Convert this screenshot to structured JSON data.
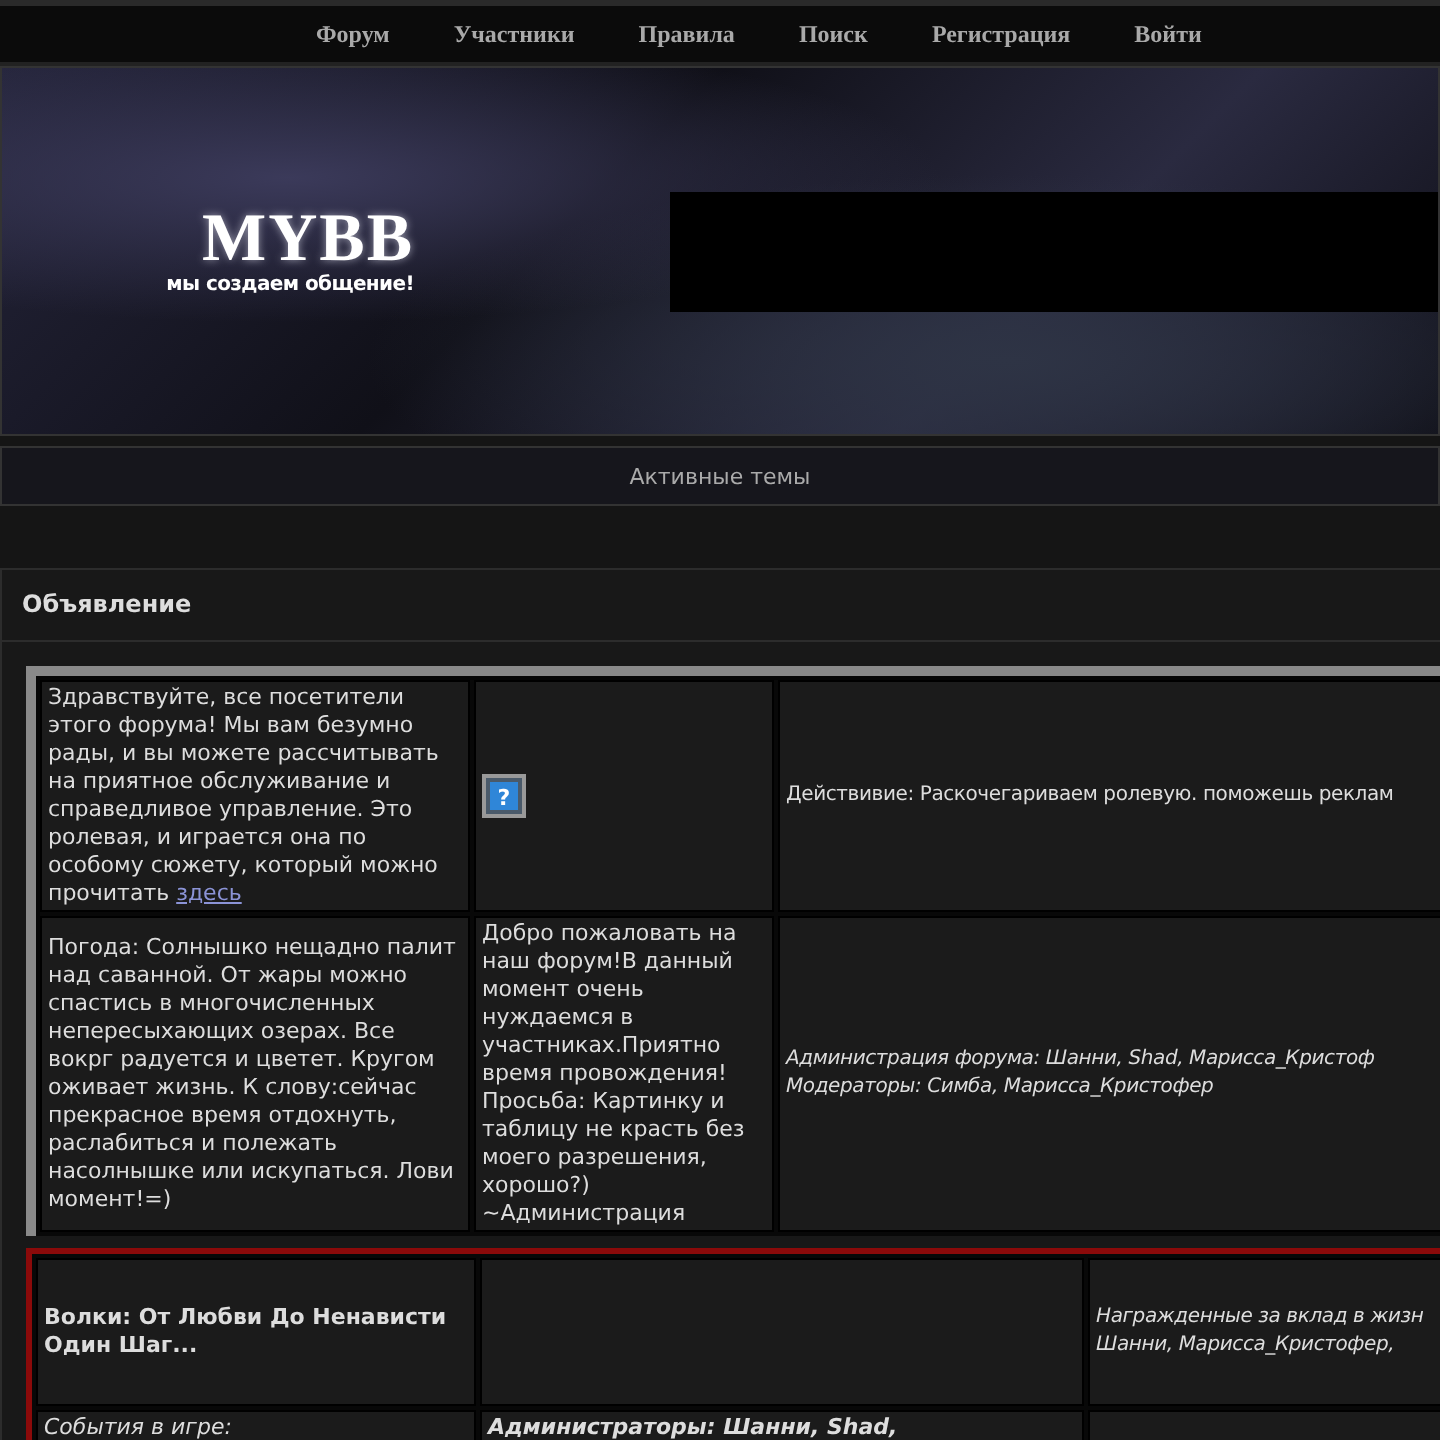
{
  "nav": {
    "items": [
      {
        "label": "Форум"
      },
      {
        "label": "Участники"
      },
      {
        "label": "Правила"
      },
      {
        "label": "Поиск"
      },
      {
        "label": "Регистрация"
      },
      {
        "label": "Войти"
      }
    ]
  },
  "banner": {
    "logo": "MYBB",
    "slogan": "мы создаем общение!"
  },
  "active_topics": {
    "label": "Активные темы"
  },
  "announcement": {
    "title": "Объявление",
    "table": {
      "rows": [
        [
          {
            "kind": "text",
            "text": "Здравствуйте, все посетители этого форума! Мы вам безумно рады, и вы можете рассчитывать на приятное обслуживание и справедливое управление. Это ролевая, и играется она по особому сюжету, который можно прочитать",
            "link": "здесь"
          },
          {
            "kind": "icon",
            "glyph": "?"
          },
          {
            "kind": "text",
            "text": "Действивие: Раскочегариваем ролевую. поможешь реклам"
          }
        ],
        [
          {
            "kind": "text",
            "text": "Погода: Солнышко нещадно палит над саванной. От жары можно спастись в многочисленных непересыхающих озерах. Все вокрг радуется и цветет. Кругом оживает жизнь. К слову:сейчас прекрасное время отдохнуть, раслабиться и полежать насолнышке или искупаться. Лови момент!=)"
          },
          {
            "kind": "text",
            "text": "Добро пожаловать на наш форум!В данный момент очень нуждаемся в участниках.Приятно время провождения! Просьба: Картинку и таблицу не красть без моего разрешения, хорошо?) ~Администрация"
          },
          {
            "kind": "text",
            "text": "Администрация форума: Шанни, Shad, Марисса_Кристоф\nМодераторы: Симба, Марисса_Кристофер"
          }
        ]
      ]
    },
    "table2": {
      "rows": [
        [
          {
            "kind": "text",
            "text": "Волки: От Любви До Ненависти Один Шаг..."
          },
          {
            "kind": "blank"
          },
          {
            "kind": "text",
            "text": "Награжденные за вклад в жизн\nШанни, Марисса_Кристофер,"
          }
        ],
        [
          {
            "kind": "text",
            "text": "События в игре:"
          },
          {
            "kind": "text",
            "text": "Администраторы: Шанни, Shad,"
          },
          {
            "kind": "blank"
          }
        ]
      ]
    }
  }
}
